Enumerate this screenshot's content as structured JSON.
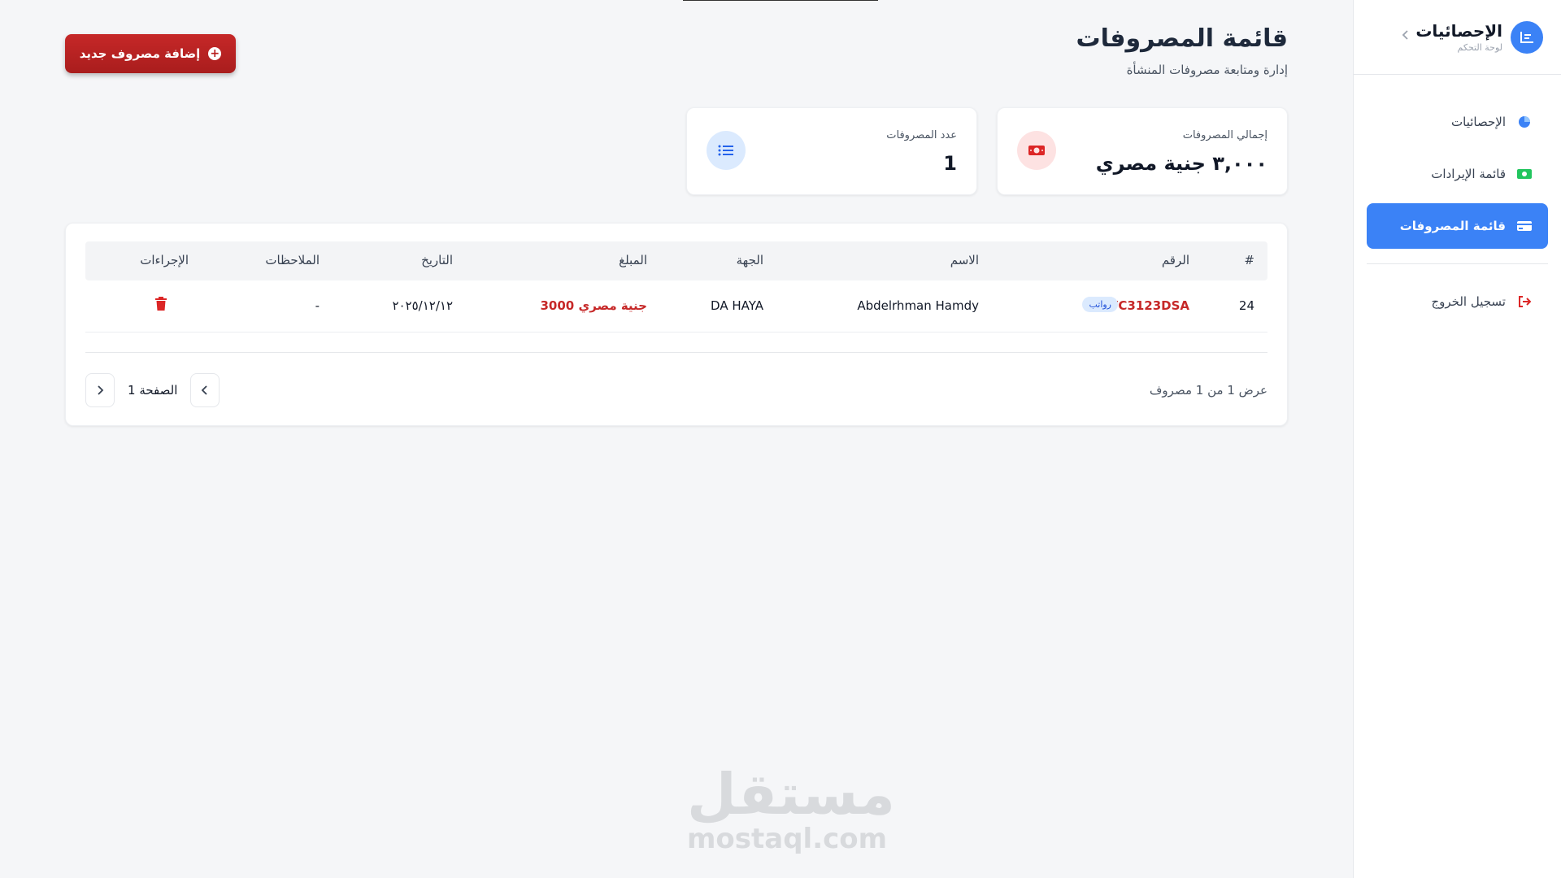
{
  "sidebar": {
    "brand_title": "الإحصائيات",
    "brand_subtitle": "لوحة التحكم",
    "items": [
      {
        "label": "الإحصائيات",
        "icon": "pie-chart-icon"
      },
      {
        "label": "قائمة الإيرادات",
        "icon": "money-icon"
      },
      {
        "label": "قائمة المصروفات",
        "icon": "credit-card-icon",
        "active": true
      }
    ],
    "logout_label": "تسجيل الخروج"
  },
  "header": {
    "title": "قائمة المصروفات",
    "subtitle": "إدارة ومتابعة مصروفات المنشأة",
    "add_button_label": "إضافة مصروف جديد"
  },
  "stats": {
    "total_label": "إجمالي المصروفات",
    "total_value": "٣,٠٠٠ جنية مصري",
    "count_label": "عدد المصروفات",
    "count_value": "1"
  },
  "table": {
    "headers": {
      "index": "#",
      "number": "الرقم",
      "name": "الاسم",
      "party": "الجهة",
      "amount": "المبلغ",
      "date": "التاريخ",
      "notes": "الملاحظات",
      "actions": "الإجراءات"
    },
    "rows": [
      {
        "index": "24",
        "number": "VC3123DSA",
        "badge": "رواتب",
        "name": "Abdelrhman Hamdy",
        "party": "DA HAYA",
        "amount": "3000 جنية مصري",
        "date": "٢٠٢٥/١٢/١٢",
        "notes": "-"
      }
    ]
  },
  "pagination": {
    "showing": "عرض 1 من 1 مصروف",
    "page_label": "الصفحة 1"
  },
  "watermark": {
    "arabic": "مستقل",
    "latin": "mostaql.com"
  },
  "colors": {
    "accent": "#3b82f6",
    "danger": "#c62828",
    "background": "#f5f6f8"
  }
}
